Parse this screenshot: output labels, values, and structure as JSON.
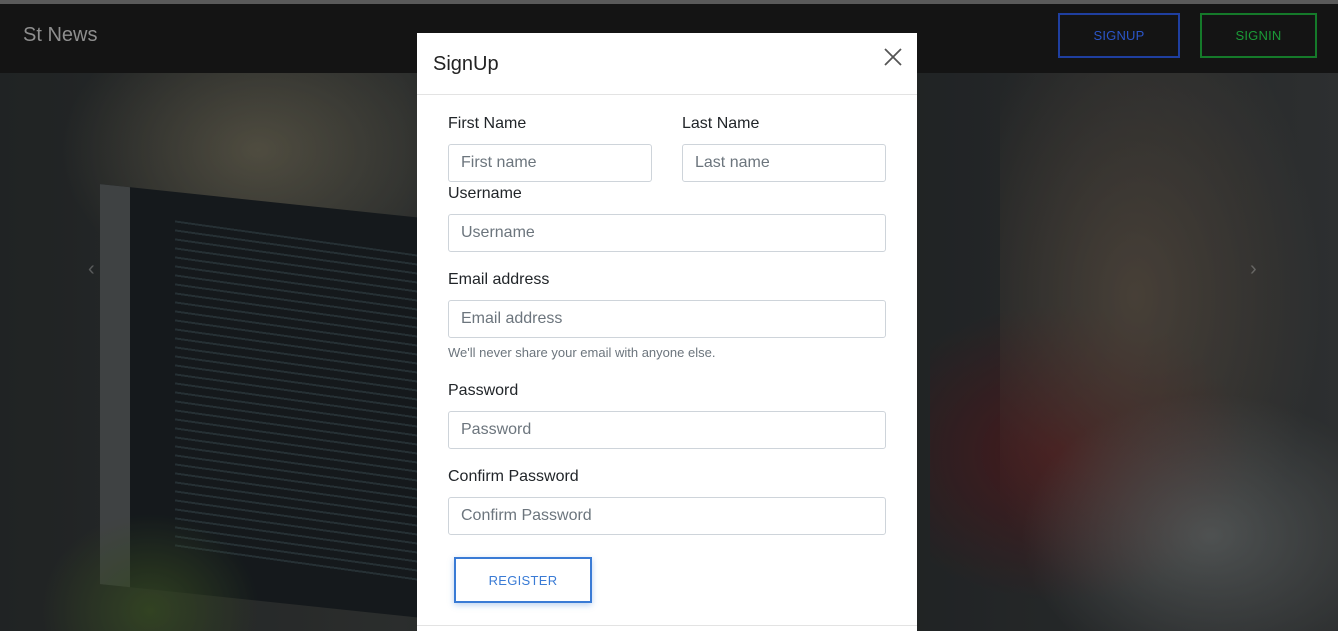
{
  "navbar": {
    "brand": "St News",
    "signup_label": "SIGNUP",
    "signin_label": "SIGNIN"
  },
  "colors": {
    "signup_accent": "#2b55c8",
    "signin_accent": "#1b9a37",
    "register_accent": "#3a7bd5"
  },
  "carousel": {
    "prev_icon": "chevron-left-icon",
    "next_icon": "chevron-right-icon"
  },
  "modal": {
    "title": "SignUp",
    "close_icon": "close-icon",
    "first_name": {
      "label": "First Name",
      "placeholder": "First name",
      "value": ""
    },
    "last_name": {
      "label": "Last Name",
      "placeholder": "Last name",
      "value": ""
    },
    "username": {
      "label": "Username",
      "placeholder": "Username",
      "value": ""
    },
    "email": {
      "label": "Email address",
      "placeholder": "Email address",
      "value": "",
      "hint": "We'll never share your email with anyone else."
    },
    "password": {
      "label": "Password",
      "placeholder": "Password",
      "value": ""
    },
    "confirm_password": {
      "label": "Confirm Password",
      "placeholder": "Confirm Password",
      "value": ""
    },
    "register_label": "REGISTER"
  }
}
